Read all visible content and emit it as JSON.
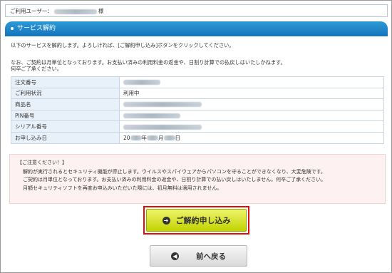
{
  "user_bar": {
    "label": "ご利用ユーザー：",
    "suffix": "様"
  },
  "section": {
    "title": "サービス解約"
  },
  "intro": {
    "line1": "以下のサービスを解約します。よろしければ、[ご解約申し込み]ボタンをクリックしてください。"
  },
  "notice": {
    "line1": "なお、ご契約は月単位となっております。お支払い済みの利用料金の返金や、日割り計算での払戻しはいたしかねます。",
    "line2": "何卒ご了承ください。"
  },
  "details": {
    "rows": [
      {
        "label": "注文番号",
        "value": ""
      },
      {
        "label": "ご利用状況",
        "value": "利用中"
      },
      {
        "label": "商品名",
        "value": ""
      },
      {
        "label": "PIN番号",
        "value": ""
      },
      {
        "label": "シリアル番号",
        "value": ""
      },
      {
        "label": "お申し込み日",
        "value_prefix": "20",
        "value_mid": "年",
        "value_suffix": "月",
        "value_end": "日"
      }
    ]
  },
  "caution": {
    "heading": "【ご注意ください！】",
    "lines": [
      "解約が実行されるとセキュリティ機能が停止します。ウイルスやスパイウェアからパソコンを守ることができなくなり、大変危険です。",
      "ご契約は月単位となっております。お支払い済みの利用料金の返金や、日割り計算での払い戻しはいたしません。何卒ご了承ください。",
      "月額セキュリティソフトを再度お申込みいただいた際には、初月無料は適用されません。"
    ]
  },
  "buttons": {
    "cancel_label": "ご解約申し込み",
    "back_label": "前へ戻る"
  },
  "colors": {
    "accent_blue": "#1574bb",
    "button_yellow": "#c2d200",
    "highlight_red": "#e30b0b",
    "caution_bg": "#fdf1f1"
  }
}
